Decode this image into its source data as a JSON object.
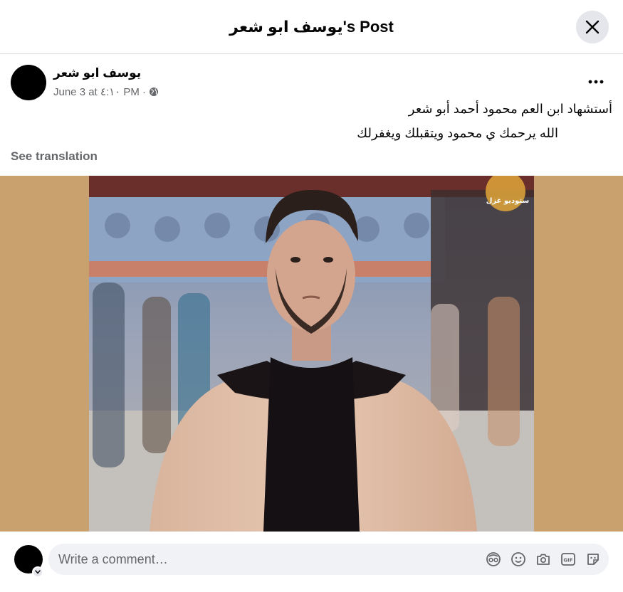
{
  "dialog": {
    "title": "يوسف ابو شعر's Post"
  },
  "post": {
    "author": "يوسف ابو شعر",
    "timestamp": "June 3 at ٤:١٠ PM",
    "separator": "·",
    "privacy_icon": "globe-icon",
    "text_line1": "أستشهاد ابن العم محمود أحمد أبو شعر",
    "text_line2": "الله يرحمك ي محمود ويتقبلك ويغفرلك",
    "see_translation": "See translation",
    "photo_watermark": "ستوديو غزل"
  },
  "comment": {
    "placeholder": "Write a comment…",
    "icons": [
      "avatar-sticker-icon",
      "emoji-icon",
      "camera-icon",
      "gif-icon",
      "sticker-icon"
    ]
  },
  "colors": {
    "media_bg": "#c9a16e",
    "secondary_text": "#65676b",
    "close_bg": "#e4e6eb",
    "input_bg": "#f0f2f5"
  }
}
